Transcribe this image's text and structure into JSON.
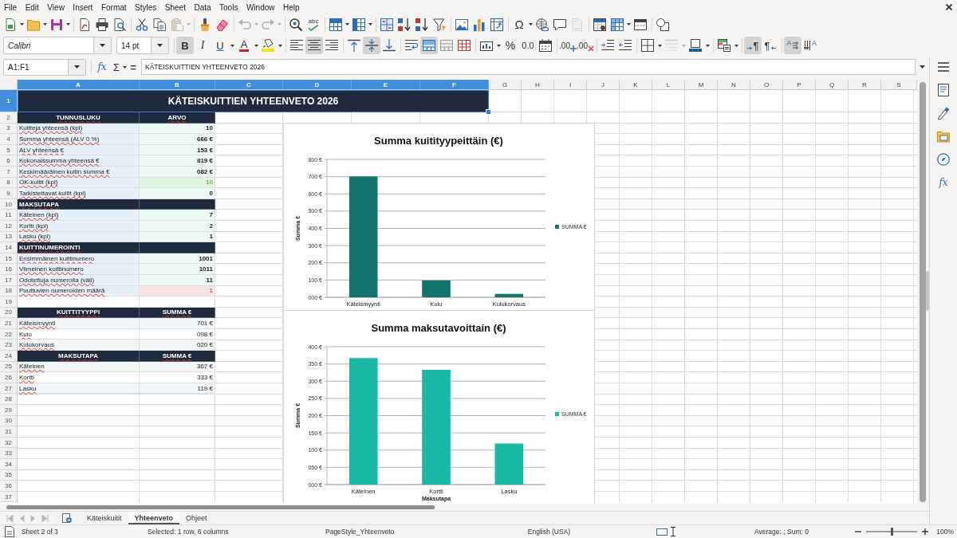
{
  "menu_bar": {
    "items": [
      "File",
      "Edit",
      "View",
      "Insert",
      "Format",
      "Styles",
      "Sheet",
      "Data",
      "Tools",
      "Window",
      "Help"
    ]
  },
  "standard_toolbar": {
    "paste": {
      "disabled": true
    },
    "undo": {
      "disabled": true
    },
    "redo": {
      "disabled": true
    },
    "spelling": {
      "glyph": "abc"
    },
    "special_character": {
      "glyph": "Ω"
    },
    "headers_footers": {
      "disabled": true
    }
  },
  "formatting_toolbar": {
    "font_name": "Calibri",
    "font_size": "14 pt",
    "bold": {
      "glyph": "B",
      "on": true
    },
    "italic": {
      "glyph": "I",
      "on": false
    },
    "underline": {
      "glyph": "U",
      "on": false
    },
    "font_color": {
      "glyph": "A"
    },
    "horizontal_align": [
      {
        "selected": false
      },
      {
        "selected": true
      },
      {
        "selected": false
      }
    ],
    "vertical_align": [
      {
        "selected": false
      },
      {
        "selected": true
      },
      {
        "selected": false
      }
    ],
    "wrap_text": {
      "on": false
    },
    "merge_and_center": {
      "on": true
    },
    "percent": {
      "glyph": "%"
    },
    "number": {
      "glyph": "0.0"
    },
    "add_decimal": {
      "glyph": ".00"
    },
    "delete_decimal": {
      "glyph": ".00"
    },
    "border_style": {
      "disabled": true
    },
    "paragraph_direction": [
      {
        "glyph": "¶",
        "selected": true
      },
      {
        "glyph": "¶",
        "selected": false
      }
    ],
    "text_direction": [
      {
        "glyph": "A",
        "selected": true
      },
      {
        "glyph": "A",
        "selected": false
      }
    ]
  },
  "formula_bar": {
    "name_box": "A1:F1",
    "function_glyph": "fx",
    "sum_glyph": "Σ",
    "equals_glyph": "=",
    "content": "KÄTEISKUITTIEN YHTEENVETO 2026"
  },
  "sidebar": {
    "functions_glyph": "fx"
  },
  "sheet": {
    "columns": [
      {
        "label": "A",
        "selected": true
      },
      {
        "label": "B",
        "selected": true
      },
      {
        "label": "C",
        "selected": true
      },
      {
        "label": "D",
        "selected": true
      },
      {
        "label": "E",
        "selected": true
      },
      {
        "label": "F",
        "selected": true
      },
      {
        "label": "G",
        "selected": false
      },
      {
        "label": "H",
        "selected": false
      },
      {
        "label": "I",
        "selected": false
      },
      {
        "label": "J",
        "selected": false
      },
      {
        "label": "K",
        "selected": false
      },
      {
        "label": "L",
        "selected": false
      },
      {
        "label": "M",
        "selected": false
      },
      {
        "label": "N",
        "selected": false
      },
      {
        "label": "O",
        "selected": false
      },
      {
        "label": "P",
        "selected": false
      },
      {
        "label": "Q",
        "selected": false
      },
      {
        "label": "R",
        "selected": false
      },
      {
        "label": "S",
        "selected": false
      }
    ],
    "rows": [
      {
        "label": "1",
        "selected": true,
        "kind": "title",
        "cells": [
          {
            "text": "KÄTEISKUITTIEN YHTEENVETO 2026"
          }
        ]
      },
      {
        "label": "2",
        "selected": false,
        "kind": "header",
        "cells": [
          {
            "text": "TUNNUSLUKU"
          },
          {
            "text": "ARVO"
          }
        ]
      },
      {
        "label": "3",
        "selected": false,
        "kind": "metric",
        "cells": [
          {
            "text": "Kuitteja yhteensä (kpl)"
          },
          {
            "text": "10"
          }
        ]
      },
      {
        "label": "4",
        "selected": false,
        "kind": "metric",
        "cells": [
          {
            "text": "Summa yhteensä (ALV 0 %)"
          },
          {
            "text": "666 €"
          }
        ]
      },
      {
        "label": "5",
        "selected": false,
        "kind": "metric",
        "cells": [
          {
            "text": "ALV yhteensä €"
          },
          {
            "text": "153 €"
          }
        ]
      },
      {
        "label": "6",
        "selected": false,
        "kind": "metric",
        "cells": [
          {
            "text": "Kokonaissumma yhteensä €"
          },
          {
            "text": "819 €"
          }
        ]
      },
      {
        "label": "7",
        "selected": false,
        "kind": "metric",
        "cells": [
          {
            "text": "Keskimääräinen kuitin summa €"
          },
          {
            "text": "082 €"
          }
        ]
      },
      {
        "label": "8",
        "selected": false,
        "kind": "metric",
        "cells": [
          {
            "text": "OK-kuitit (kpl)"
          },
          {
            "text": "10",
            "color": "#e2f3df"
          }
        ]
      },
      {
        "label": "9",
        "selected": false,
        "kind": "metric",
        "cells": [
          {
            "text": "Tarkistettavat kuitit (kpl)"
          },
          {
            "text": "0"
          }
        ]
      },
      {
        "label": "10",
        "selected": false,
        "kind": "section",
        "cells": [
          {
            "text": "MAKSUTAPA"
          }
        ]
      },
      {
        "label": "11",
        "selected": false,
        "kind": "metric",
        "cells": [
          {
            "text": "Käteinen (kpl)"
          },
          {
            "text": "7"
          }
        ]
      },
      {
        "label": "12",
        "selected": false,
        "kind": "metric",
        "cells": [
          {
            "text": "Kortti (kpl)"
          },
          {
            "text": "2"
          }
        ]
      },
      {
        "label": "13",
        "selected": false,
        "kind": "metric",
        "cells": [
          {
            "text": "Lasku (kpl)"
          },
          {
            "text": "1"
          }
        ]
      },
      {
        "label": "14",
        "selected": false,
        "kind": "section",
        "cells": [
          {
            "text": "KUITTINUMEROINTI"
          }
        ]
      },
      {
        "label": "15",
        "selected": false,
        "kind": "metric",
        "cells": [
          {
            "text": "Ensimmäinen kuittinumero"
          },
          {
            "text": "1001"
          }
        ]
      },
      {
        "label": "16",
        "selected": false,
        "kind": "metric",
        "cells": [
          {
            "text": "Viimeinen kuittinumero"
          },
          {
            "text": "1011"
          }
        ]
      },
      {
        "label": "17",
        "selected": false,
        "kind": "metric",
        "cells": [
          {
            "text": "Odotettuja numeroita (väli)"
          },
          {
            "text": "11"
          }
        ]
      },
      {
        "label": "18",
        "selected": false,
        "kind": "metric",
        "cells": [
          {
            "text": "Puuttuvien numeroiden määrä"
          },
          {
            "text": "1",
            "color": "#fbe2e2"
          }
        ]
      },
      {
        "label": "19",
        "selected": false,
        "kind": "blank"
      },
      {
        "label": "20",
        "selected": false,
        "kind": "header",
        "cells": [
          {
            "text": "KUITTITYYPPI"
          },
          {
            "text": "SUMMA €"
          }
        ]
      },
      {
        "label": "21",
        "selected": false,
        "kind": "amount",
        "cells": [
          {
            "text": "Käteismyynti"
          },
          {
            "text": "701 €"
          }
        ]
      },
      {
        "label": "22",
        "selected": false,
        "kind": "amount",
        "cells": [
          {
            "text": "Kulu"
          },
          {
            "text": "098 €"
          }
        ]
      },
      {
        "label": "23",
        "selected": false,
        "kind": "amount",
        "cells": [
          {
            "text": "Kulukorvaus"
          },
          {
            "text": "020 €"
          }
        ]
      },
      {
        "label": "24",
        "selected": false,
        "kind": "header",
        "cells": [
          {
            "text": "MAKSUTAPA"
          },
          {
            "text": "SUMMA €"
          }
        ]
      },
      {
        "label": "25",
        "selected": false,
        "kind": "amount",
        "cells": [
          {
            "text": "Käteinen"
          },
          {
            "text": "367 €"
          }
        ]
      },
      {
        "label": "26",
        "selected": false,
        "kind": "amount",
        "cells": [
          {
            "text": "Kortti"
          },
          {
            "text": "333 €"
          }
        ]
      },
      {
        "label": "27",
        "selected": false,
        "kind": "amount",
        "cells": [
          {
            "text": "Lasku"
          },
          {
            "text": "119 €"
          }
        ]
      },
      {
        "label": "28",
        "selected": false,
        "kind": "blank"
      },
      {
        "label": "29",
        "selected": false,
        "kind": "blank"
      },
      {
        "label": "30",
        "selected": false,
        "kind": "blank"
      },
      {
        "label": "31",
        "selected": false,
        "kind": "blank"
      },
      {
        "label": "32",
        "selected": false,
        "kind": "blank"
      },
      {
        "label": "33",
        "selected": false,
        "kind": "blank"
      },
      {
        "label": "34",
        "selected": false,
        "kind": "blank"
      },
      {
        "label": "35",
        "selected": false,
        "kind": "blank"
      },
      {
        "label": "36",
        "selected": false,
        "kind": "blank"
      },
      {
        "label": "37",
        "selected": false,
        "kind": "blank"
      }
    ],
    "charts": [
      {
        "chart_data": {
          "type": "bar",
          "title": "Summa kuitityypeittäin (€)",
          "ylabel": "Summa €",
          "categories": [
            "Käteismyynti",
            "Kulu",
            "Kulukorvaus"
          ],
          "series": [
            {
              "name": "SUMMA €",
              "color": "#12756b",
              "values": [
                701,
                98,
                20
              ]
            }
          ],
          "ylim": [
            0,
            800
          ],
          "grid": true,
          "yticks": [
            {
              "value": 0,
              "label": "000 €"
            },
            {
              "value": 100,
              "label": "100 €"
            },
            {
              "value": 200,
              "label": "200 €"
            },
            {
              "value": 300,
              "label": "300 €"
            },
            {
              "value": 400,
              "label": "400 €"
            },
            {
              "value": 500,
              "label": "500 €"
            },
            {
              "value": 600,
              "label": "600 €"
            },
            {
              "value": 700,
              "label": "700 €"
            },
            {
              "value": 800,
              "label": "800 €"
            }
          ]
        }
      },
      {
        "chart_data": {
          "type": "bar",
          "title": "Summa maksutavoittain (€)",
          "xlabel": "Maksutapa",
          "ylabel": "Summa €",
          "categories": [
            "Käteinen",
            "Kortti",
            "Lasku"
          ],
          "series": [
            {
              "name": "SUMMA €",
              "color": "#19b8a5",
              "values": [
                367,
                333,
                119
              ]
            }
          ],
          "ylim": [
            0,
            400
          ],
          "grid": true,
          "yticks": [
            {
              "value": 0,
              "label": "000 €"
            },
            {
              "value": 50,
              "label": "050 €"
            },
            {
              "value": 100,
              "label": "100 €"
            },
            {
              "value": 150,
              "label": "150 €"
            },
            {
              "value": 200,
              "label": "200 €"
            },
            {
              "value": 250,
              "label": "250 €"
            },
            {
              "value": 300,
              "label": "300 €"
            },
            {
              "value": 350,
              "label": "350 €"
            },
            {
              "value": 400,
              "label": "400 €"
            }
          ]
        }
      }
    ]
  },
  "sheet_tabs": {
    "navigation_disabled": true,
    "tabs": [
      {
        "label": "Käteiskuitit",
        "selected": false
      },
      {
        "label": "Yhteenveto",
        "selected": true
      },
      {
        "label": "Ohjeet",
        "selected": false
      }
    ]
  },
  "status_bar": {
    "sheet": "Sheet 2 of 3",
    "selection": "Selected: 1 row, 6 columns",
    "page_style": "PageStyle_Yhteenveto",
    "language": "English (USA)",
    "summary": "Average: ; Sum: 0",
    "zoom": {
      "level": 0.5,
      "reading": "100%"
    }
  }
}
